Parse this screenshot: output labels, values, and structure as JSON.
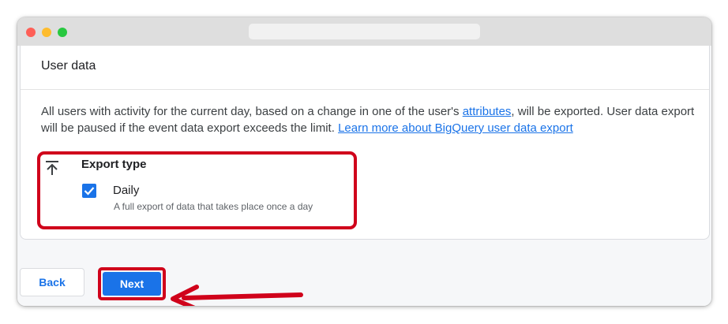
{
  "card": {
    "title": "User data",
    "description": {
      "part1": "All users with activity for the current day, based on a change in one of the user's ",
      "attributes_link": "attributes",
      "part2": ", will be exported. User data export will be paused if the event data export exceeds the limit. ",
      "learn_more_link": "Learn more about BigQuery user data export"
    },
    "export_type": {
      "label": "Export type",
      "icon": "upload-arrow-icon",
      "option": {
        "label": "Daily",
        "sublabel": "A full export of data that takes place once a day",
        "checked": true
      }
    }
  },
  "footer": {
    "back_label": "Back",
    "next_label": "Next"
  },
  "colors": {
    "accent": "#1a73e8",
    "annotation": "#d0021b"
  }
}
